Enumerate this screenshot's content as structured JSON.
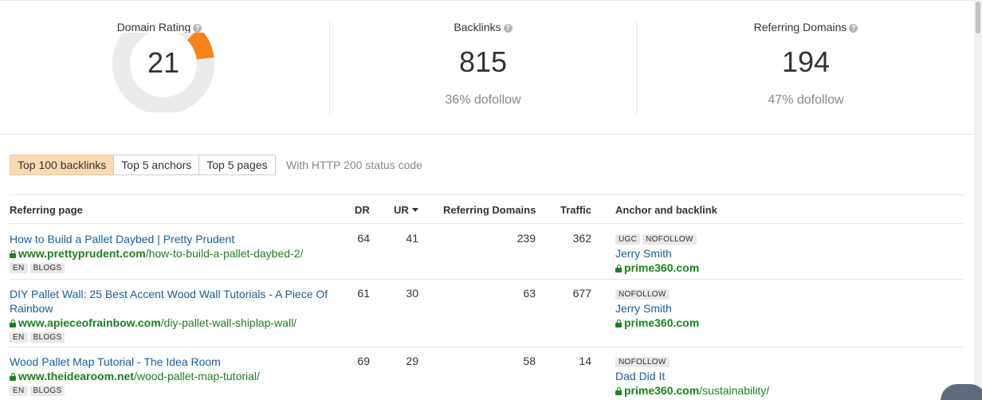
{
  "stats": {
    "domain_rating": {
      "title": "Domain Rating",
      "value": "21",
      "fraction": 0.21,
      "accent_color": "#f5861f",
      "track_color": "#ebebeb"
    },
    "backlinks": {
      "title": "Backlinks",
      "value": "815",
      "sub": "36% dofollow"
    },
    "referring_domains": {
      "title": "Referring Domains",
      "value": "194",
      "sub": "47% dofollow"
    }
  },
  "tabs": [
    {
      "label": "Top 100 backlinks",
      "active": true
    },
    {
      "label": "Top 5 anchors",
      "active": false
    },
    {
      "label": "Top 5 pages",
      "active": false
    }
  ],
  "status_note": "With HTTP 200 status code",
  "table": {
    "headers": {
      "referring_page": "Referring page",
      "dr": "DR",
      "ur": "UR",
      "referring_domains": "Referring Domains",
      "traffic": "Traffic",
      "anchor": "Anchor and backlink"
    },
    "rows": [
      {
        "title": "How to Build a Pallet Daybed | Pretty Prudent",
        "domain": "www.prettyprudent.com",
        "path": "/how-to-build-a-pallet-daybed-2/",
        "tags": [
          "EN",
          "BLOGS"
        ],
        "dr": "64",
        "ur": "41",
        "ref_domains": "239",
        "traffic": "362",
        "link_tags": [
          "UGC",
          "NOFOLLOW"
        ],
        "anchor": "Jerry Smith",
        "target_domain": "prime360.com",
        "target_path": ""
      },
      {
        "title_line1": "DIY Pallet Wall: 25 Best Accent Wood Wall Tutorials - A Piece Of",
        "title_line2": "Rainbow",
        "domain": "www.apieceofrainbow.com",
        "path": "/diy-pallet-wall-shiplap-wall/",
        "tags": [
          "EN",
          "BLOGS"
        ],
        "dr": "61",
        "ur": "30",
        "ref_domains": "63",
        "traffic": "677",
        "link_tags": [
          "NOFOLLOW"
        ],
        "anchor": "Jerry Smith",
        "target_domain": "prime360.com",
        "target_path": ""
      },
      {
        "title": "Wood Pallet Map Tutorial - The Idea Room",
        "domain": "www.theidearoom.net",
        "path": "/wood-pallet-map-tutorial/",
        "tags": [
          "EN",
          "BLOGS"
        ],
        "dr": "69",
        "ur": "29",
        "ref_domains": "58",
        "traffic": "14",
        "link_tags": [
          "NOFOLLOW"
        ],
        "anchor": "Dad Did It",
        "target_domain": "prime360.com",
        "target_path": "/sustainability/"
      }
    ]
  }
}
